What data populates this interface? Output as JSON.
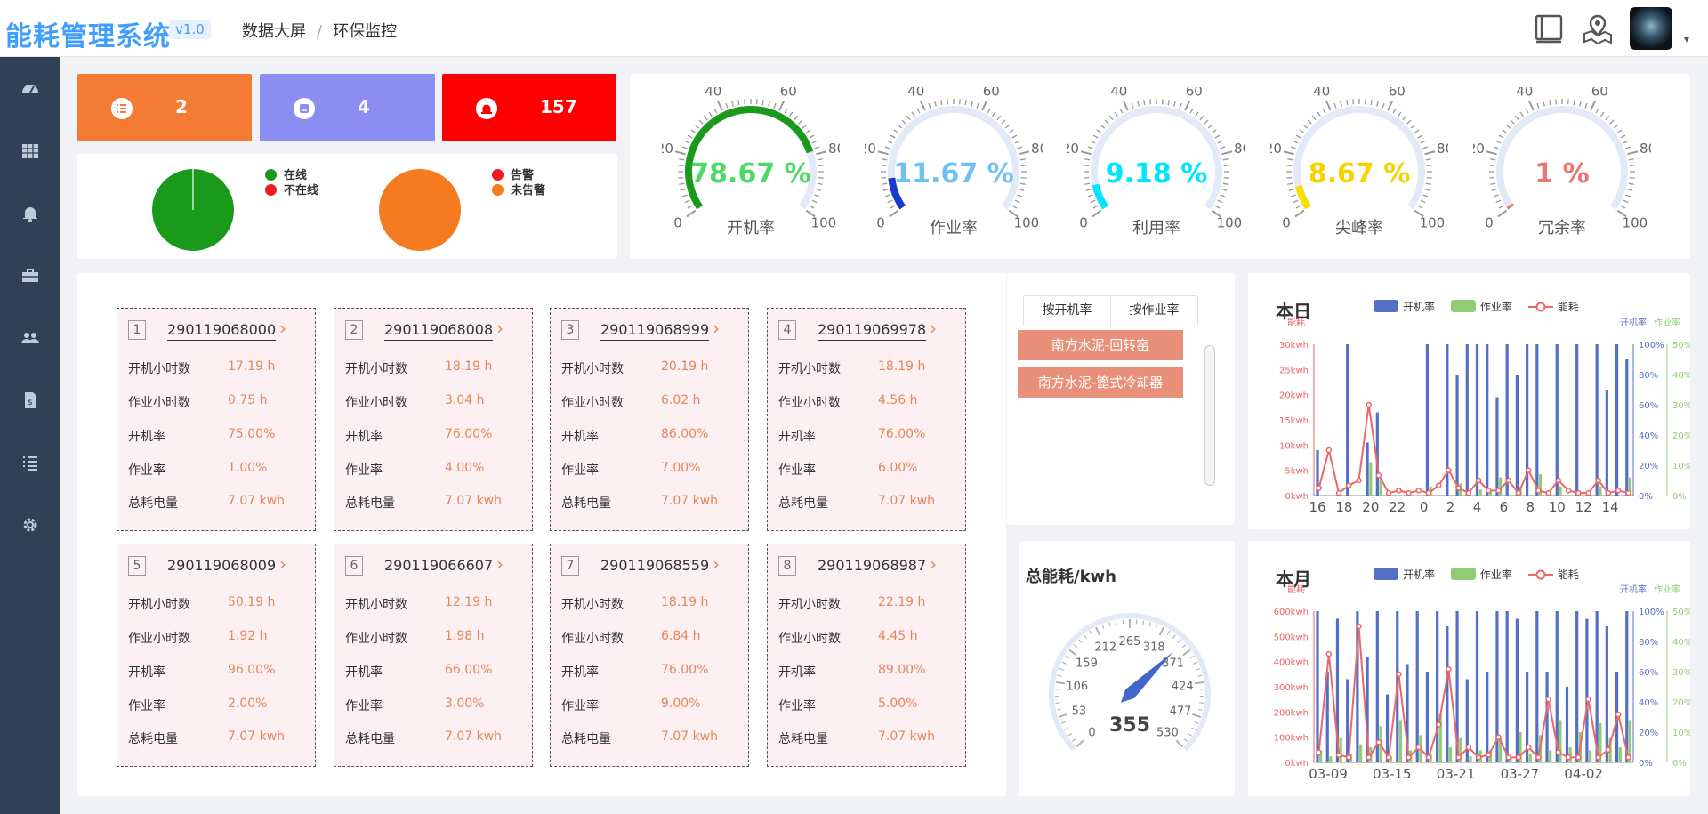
{
  "header": {
    "logo": "能耗管理系统",
    "version": "v1.0",
    "breadcrumb": [
      "数据大屏",
      "环保监控"
    ]
  },
  "sidebar": {
    "items": [
      "dashboard-icon",
      "table-icon",
      "bell-icon",
      "toolbox-icon",
      "team-icon",
      "document-icon",
      "list-icon",
      "settings-gear-icon"
    ]
  },
  "stats": [
    {
      "value": "2",
      "color": "#f47b34",
      "icon": "list-icon"
    },
    {
      "value": "4",
      "color": "#8b8df0",
      "icon": "device-icon"
    },
    {
      "value": "157",
      "color": "#fe0000",
      "icon": "alarm-icon"
    }
  ],
  "pies": {
    "online": {
      "legend": [
        "在线",
        "不在线"
      ],
      "colors": [
        "#1a9a1a",
        "#ee1d1d"
      ],
      "values": [
        1,
        0.003
      ]
    },
    "alarm": {
      "legend": [
        "告警",
        "未告警"
      ],
      "colors": [
        "#ee1d1d",
        "#f47b20"
      ],
      "values": [
        0,
        1
      ]
    }
  },
  "gauges": [
    {
      "label": "开机率",
      "value_text": "78.67 %",
      "value": 78.67,
      "color": "#4cd964",
      "arc": "#1a9a1a"
    },
    {
      "label": "作业率",
      "value_text": "11.67 %",
      "value": 11.67,
      "color": "#6ec1f5",
      "arc": "#1838d4"
    },
    {
      "label": "利用率",
      "value_text": "9.18 %",
      "value": 9.18,
      "color": "#00e5ff",
      "arc": "#00e5ff"
    },
    {
      "label": "尖峰率",
      "value_text": "8.67 %",
      "value": 8.67,
      "color": "#f5d300",
      "arc": "#f5e000"
    },
    {
      "label": "冗余率",
      "value_text": "1 %",
      "value": 1,
      "color": "#e8776f",
      "arc": "#e8776f"
    }
  ],
  "gauge_ticks": [
    "0",
    "20",
    "40",
    "60",
    "80",
    "100"
  ],
  "card_labels": [
    "开机小时数",
    "作业小时数",
    "开机率",
    "作业率",
    "总耗电量"
  ],
  "devices": [
    {
      "idx": "1",
      "sn": "290119068000",
      "vals": [
        "17.19 h",
        "0.75 h",
        "75.00%",
        "1.00%",
        "7.07 kwh"
      ]
    },
    {
      "idx": "2",
      "sn": "290119068008",
      "vals": [
        "18.19 h",
        "3.04 h",
        "76.00%",
        "4.00%",
        "7.07 kwh"
      ]
    },
    {
      "idx": "3",
      "sn": "290119068999",
      "vals": [
        "20.19 h",
        "6.02 h",
        "86.00%",
        "7.00%",
        "7.07 kwh"
      ]
    },
    {
      "idx": "4",
      "sn": "290119069978",
      "vals": [
        "18.19 h",
        "4.56 h",
        "76.00%",
        "6.00%",
        "7.07 kwh"
      ]
    },
    {
      "idx": "5",
      "sn": "290119068009",
      "vals": [
        "50.19 h",
        "1.92 h",
        "96.00%",
        "2.00%",
        "7.07 kwh"
      ]
    },
    {
      "idx": "6",
      "sn": "290119066607",
      "vals": [
        "12.19 h",
        "1.98 h",
        "66.00%",
        "3.00%",
        "7.07 kwh"
      ]
    },
    {
      "idx": "7",
      "sn": "290119068559",
      "vals": [
        "18.19 h",
        "6.84 h",
        "76.00%",
        "9.00%",
        "7.07 kwh"
      ]
    },
    {
      "idx": "8",
      "sn": "290119068987",
      "vals": [
        "22.19 h",
        "4.45 h",
        "89.00%",
        "5.00%",
        "7.07 kwh"
      ]
    }
  ],
  "tabs": [
    "按开机率",
    "按作业率"
  ],
  "projects": [
    "南方水泥-回转窑",
    "南方水泥-篦式冷却器"
  ],
  "total_energy": {
    "title": "总能耗/kwh",
    "value": 355,
    "value_text": "355",
    "max": 530,
    "ticks": [
      "0",
      "53",
      "106",
      "159",
      "212",
      "265",
      "318",
      "371",
      "424",
      "477",
      "530"
    ]
  },
  "chart_data": [
    {
      "type": "bar",
      "title": "本日",
      "legend": [
        "开机率",
        "作业率",
        "能耗"
      ],
      "axis_names": {
        "left": "能耗",
        "right1": "开机率",
        "right2": "作业率"
      },
      "colors": {
        "kaiji": "#5470c6",
        "zuoye": "#91cc75",
        "energy": "#ee6666"
      },
      "x_ticks": [
        "16",
        "18",
        "20",
        "22",
        "0",
        "2",
        "4",
        "6",
        "8",
        "10",
        "12",
        "14"
      ],
      "y_left_ticks": [
        "0kwh",
        "5kwh",
        "10kwh",
        "15kwh",
        "20kwh",
        "25kwh",
        "30kwh"
      ],
      "y_right1_ticks": [
        "0%",
        "20%",
        "40%",
        "60%",
        "80%",
        "100%"
      ],
      "y_right2_ticks": [
        "0%",
        "10%",
        "20%",
        "30%",
        "40%",
        "50%"
      ],
      "series": [
        {
          "name": "开机率",
          "values": [
            30,
            0,
            0,
            100,
            0,
            35,
            55,
            0,
            0,
            0,
            0,
            100,
            0,
            100,
            80,
            100,
            100,
            100,
            65,
            100,
            80,
            100,
            100,
            0,
            100,
            0,
            100,
            0,
            100,
            70,
            100,
            90
          ]
        },
        {
          "name": "作业率",
          "values": [
            0,
            0,
            0,
            0,
            0,
            11,
            5,
            0,
            0,
            0,
            0,
            3,
            0,
            0,
            4,
            0,
            2,
            2,
            6,
            0,
            3,
            0,
            7,
            0,
            3,
            0,
            0,
            0,
            3,
            0,
            0,
            6
          ]
        },
        {
          "name": "能耗",
          "values": [
            1.5,
            9,
            0.5,
            2,
            3,
            18,
            4,
            0.5,
            1,
            0.5,
            1,
            0.5,
            2,
            5,
            1.5,
            0.5,
            3,
            1,
            1,
            3,
            0.5,
            5,
            1,
            0.5,
            3,
            1,
            0.5,
            0.5,
            3,
            0.5,
            1,
            0.5
          ]
        }
      ],
      "ylim_left": [
        0,
        30
      ]
    },
    {
      "type": "bar",
      "title": "本月",
      "legend": [
        "开机率",
        "作业率",
        "能耗"
      ],
      "axis_names": {
        "left": "能耗",
        "right1": "开机率",
        "right2": "作业率"
      },
      "colors": {
        "kaiji": "#5470c6",
        "zuoye": "#91cc75",
        "energy": "#ee6666"
      },
      "x_ticks": [
        "03-09",
        "03-15",
        "03-21",
        "03-27",
        "04-02"
      ],
      "y_left_ticks": [
        "0kwh",
        "100kwh",
        "200kwh",
        "300kwh",
        "400kwh",
        "500kwh",
        "600kwh"
      ],
      "y_right1_ticks": [
        "0%",
        "20%",
        "40%",
        "60%",
        "80%",
        "100%"
      ],
      "y_right2_ticks": [
        "0%",
        "10%",
        "20%",
        "30%",
        "40%",
        "50%"
      ],
      "series": [
        {
          "name": "开机率",
          "values": [
            100,
            60,
            95,
            55,
            100,
            70,
            100,
            45,
            100,
            65,
            100,
            60,
            100,
            90,
            100,
            55,
            100,
            60,
            100,
            100,
            95,
            60,
            100,
            60,
            100,
            50,
            100,
            95,
            100,
            90,
            60,
            100
          ]
        },
        {
          "name": "作业率",
          "values": [
            4,
            2,
            8,
            3,
            6,
            5,
            12,
            2,
            14,
            4,
            9,
            3,
            16,
            5,
            8,
            2,
            4,
            4,
            8,
            2,
            10,
            3,
            9,
            4,
            14,
            5,
            10,
            4,
            13,
            8,
            5,
            14
          ]
        },
        {
          "name": "能耗",
          "values": [
            40,
            430,
            30,
            20,
            540,
            20,
            80,
            20,
            350,
            20,
            60,
            20,
            150,
            370,
            20,
            60,
            20,
            30,
            100,
            20,
            20,
            60,
            20,
            250,
            40,
            20,
            20,
            250,
            20,
            50,
            190,
            20
          ]
        }
      ],
      "ylim_left": [
        0,
        600
      ]
    }
  ]
}
